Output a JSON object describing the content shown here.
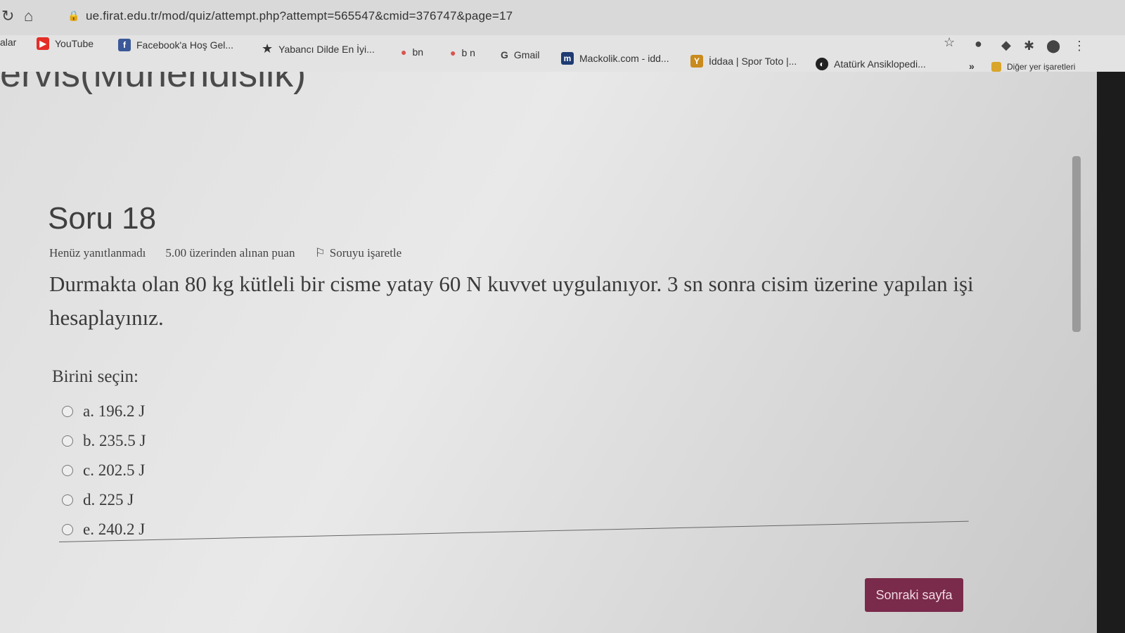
{
  "browser": {
    "url": "ue.firat.edu.tr/mod/quiz/attempt.php?attempt=565547&cmid=376747&page=17",
    "bookmarks": [
      {
        "label": "alar",
        "icon": "apps-icon"
      },
      {
        "label": "YouTube",
        "icon": "youtube-icon"
      },
      {
        "label": "Facebook'a Hoş Gel...",
        "icon": "facebook-icon"
      },
      {
        "label": "Yabancı Dilde En İyi...",
        "icon": "star-icon"
      },
      {
        "label": "bn",
        "icon": "bookmark-icon"
      },
      {
        "label": "b n",
        "icon": "bookmark-icon"
      },
      {
        "label": "Gmail",
        "icon": "google-icon"
      },
      {
        "label": "Mackolik.com - idd...",
        "icon": "mackolik-icon"
      },
      {
        "label": "İddaa | Spor Toto |...",
        "icon": "iddaa-icon"
      },
      {
        "label": "Atatürk Ansiklopedi...",
        "icon": "globe-icon"
      }
    ],
    "more_bookmarks": "»",
    "other_bookmarks": "Diğer yer işaretleri"
  },
  "page": {
    "course_title": "ervis(Mühendislik)",
    "question_title": "Soru 18",
    "status": "Henüz yanıtlanmadı",
    "points": "5.00 üzerinden alınan puan",
    "flag_label": "Soruyu işaretle",
    "question_text": "Durmakta olan 80 kg kütleli bir cisme yatay 60 N kuvvet uygulanıyor. 3 sn sonra cisim üzerine yapılan işi hesaplayınız.",
    "prompt": "Birini seçin:",
    "answers": [
      "a. 196.2 J",
      "b. 235.5 J",
      "c. 202.5 J",
      "d. 225 J",
      "e. 240.2 J"
    ],
    "next_button": "Sonraki sayfa"
  },
  "colors": {
    "next_button_bg": "#7a2a4a",
    "youtube": "#e52d27",
    "facebook": "#3b5998"
  }
}
